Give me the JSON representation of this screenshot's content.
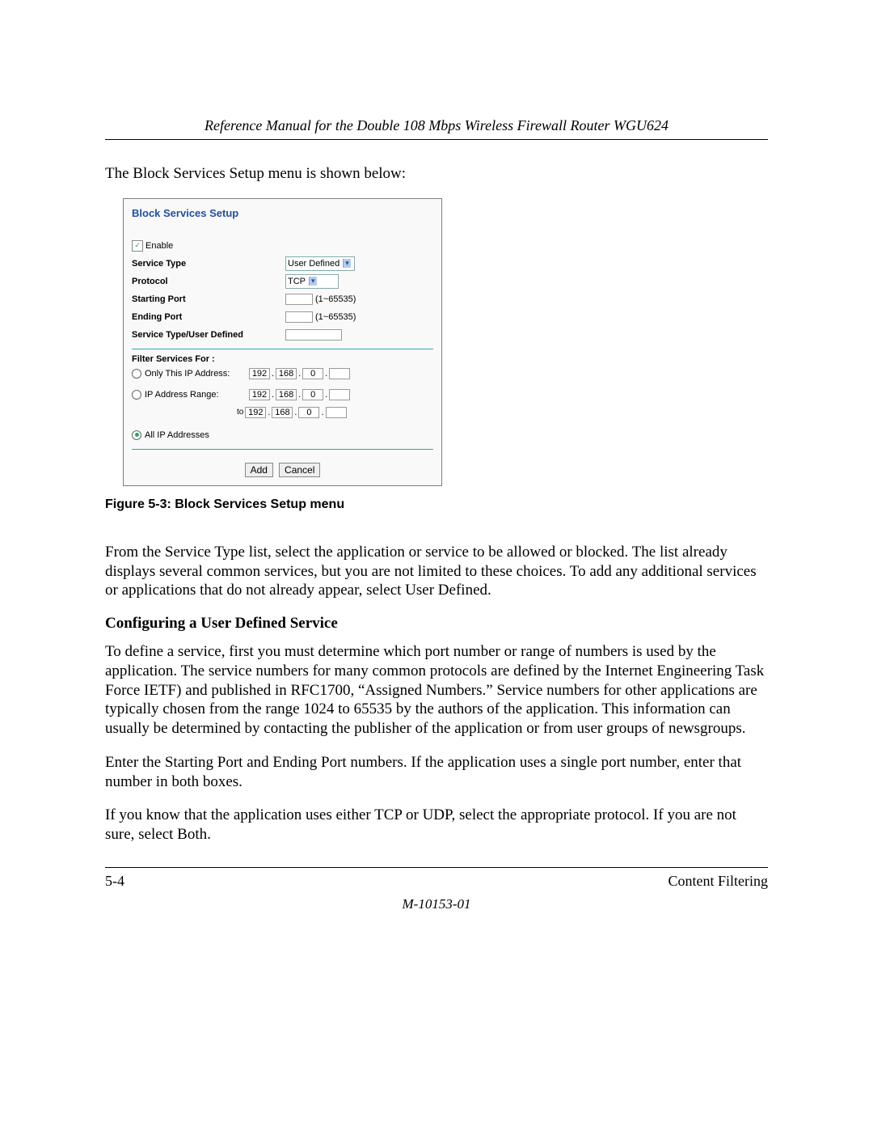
{
  "header": {
    "manual_title": "Reference Manual for the Double 108 Mbps Wireless Firewall Router WGU624"
  },
  "intro_text": "The Block Services Setup menu is shown below:",
  "figure": {
    "title": "Block Services Setup",
    "enable_label": "Enable",
    "rows": {
      "service_type_label": "Service Type",
      "service_type_value": "User Defined",
      "protocol_label": "Protocol",
      "protocol_value": "TCP",
      "starting_port_label": "Starting Port",
      "starting_port_hint": "(1~65535)",
      "ending_port_label": "Ending Port",
      "ending_port_hint": "(1~65535)",
      "user_defined_label": "Service Type/User Defined"
    },
    "filter": {
      "heading": "Filter Services For :",
      "only_label": "Only This IP Address:",
      "range_label": "IP Address Range:",
      "to_label": "to",
      "all_label": "All IP Addresses",
      "ip": {
        "a": "192",
        "b": "168",
        "c": "0",
        "d": ""
      }
    },
    "buttons": {
      "add": "Add",
      "cancel": "Cancel"
    },
    "caption": "Figure 5-3:  Block Services Setup menu"
  },
  "paragraphs": {
    "p1": "From the Service Type list, select the application or service to be allowed or blocked. The list already displays several common services, but you are not limited to these choices. To add any additional services or applications that do not already appear, select User Defined.",
    "h2": "Configuring a User Defined Service",
    "p2": "To define a service, first you must determine which port number or range of numbers is used by the application. The service numbers for many common protocols are defined by the Internet Engineering Task Force IETF) and published in RFC1700, “Assigned Numbers.” Service numbers for other applications are typically chosen from the range 1024 to 65535 by the authors of the application. This information can usually be determined by contacting the publisher of the application or from user groups of newsgroups.",
    "p3": "Enter the Starting Port and Ending Port numbers. If the application uses a single port number, enter that number in both boxes.",
    "p4": "If you know that the application uses either TCP or UDP, select the appropriate protocol. If you are not sure, select Both."
  },
  "footer": {
    "page_num": "5-4",
    "section": "Content Filtering",
    "doc_code": "M-10153-01"
  }
}
